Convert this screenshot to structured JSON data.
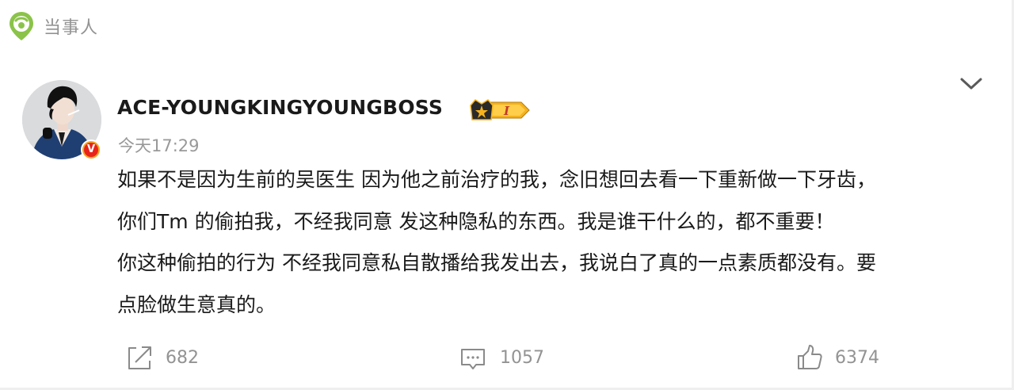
{
  "header": {
    "label": "当事人",
    "icon": "location-pin-icon"
  },
  "post": {
    "username": "ACE-YOUNGKINGYOUNGBOSS",
    "verified_badge": "V",
    "rank_badge": "I",
    "timestamp": "今天17:29",
    "content_lines": [
      "如果不是因为生前的吴医生 因为他之前治疗的我，念旧想回去看一下重新做一下牙齿，",
      "你们Tm 的偷拍我，不经我同意 发这种隐私的东西。我是谁干什么的，都不重要！",
      "你这种偷拍的行为 不经我同意私自散播给我发出去，我说白了真的一点素质都没有。要",
      "点脸做生意真的。"
    ]
  },
  "actions": {
    "share": {
      "count": "682",
      "icon": "share-icon"
    },
    "comment": {
      "count": "1057",
      "icon": "comment-icon"
    },
    "like": {
      "count": "6374",
      "icon": "thumbs-up-icon"
    }
  },
  "colors": {
    "accent_green": "#8bc34a",
    "muted_text": "#939393",
    "verified_red": "#e8231b",
    "verified_orange": "#f5a623",
    "crown_gold": "#f5b21d"
  }
}
